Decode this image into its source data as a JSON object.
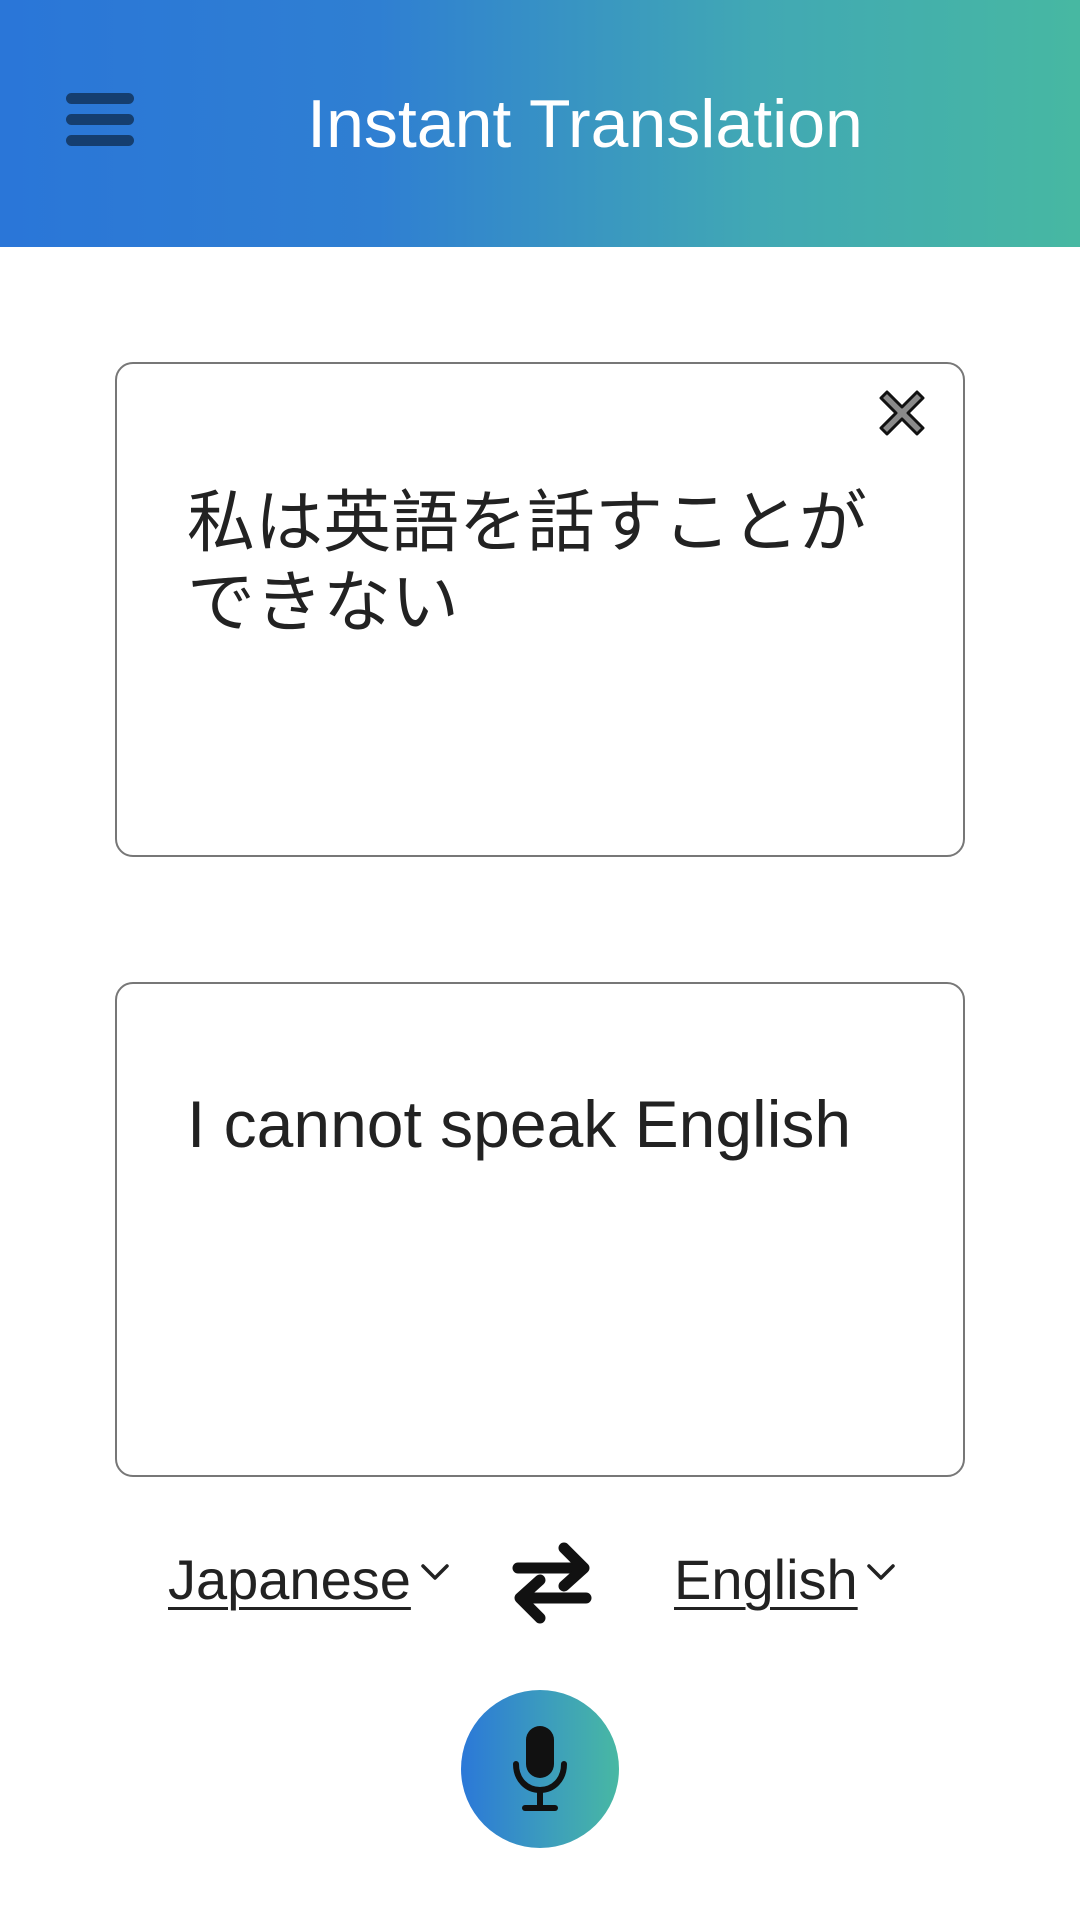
{
  "header": {
    "title": "Instant Translation",
    "menu_icon": "hamburger-menu-icon",
    "gradient": [
      "#2a76d8",
      "#47b8a2"
    ]
  },
  "source_box": {
    "text": "私は英語を話すことができない",
    "clear_icon": "close-x-icon"
  },
  "target_box": {
    "text": "I cannot speak English"
  },
  "languages": {
    "source": "Japanese",
    "target": "English",
    "chevron_icon": "chevron-down-icon",
    "swap_icon": "swap-arrows-icon"
  },
  "mic": {
    "icon": "microphone-icon"
  },
  "colors": {
    "menu_icon": "#153e6f",
    "text": "#222222",
    "border": "#777777"
  }
}
